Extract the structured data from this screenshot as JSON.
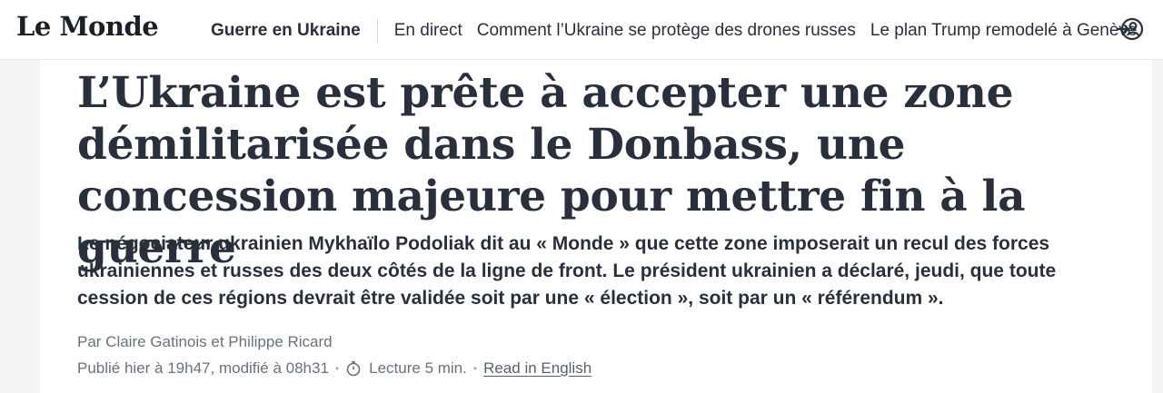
{
  "header": {
    "logo": "Le Monde",
    "nav": {
      "primary": "Guerre en Ukraine",
      "items": [
        "En direct",
        "Comment l’Ukraine se protège des drones russes",
        "Le plan Trump remodelé à Genève"
      ]
    },
    "account_icon": "login-user-icon"
  },
  "article": {
    "headline": "L’Ukraine est prête à accepter une zone démilitarisée dans le Donbass, une concession majeure pour mettre fin à la guerre",
    "standfirst": "Le négociateur ukrainien Mykhaïlo Podoliak dit au « Monde » que cette zone imposerait un recul des forces ukrainiennes et russes des deux côtés de la ligne de front. Le président ukrainien a déclaré, jeudi, que toute cession de ces régions devrait être validée soit par une « élection », soit par un « référendum ».",
    "byline": "Par Claire Gatinois et Philippe Ricard",
    "published": "Publié hier à 19h47, modifié à 08h31",
    "reading_time": "Lecture 5 min.",
    "read_in_english": "Read in English",
    "separator": "•",
    "timer_icon": "stopwatch-icon"
  },
  "colors": {
    "text": "#2a303b",
    "meta": "#6b717b",
    "gutter": "#f3f4f6"
  }
}
